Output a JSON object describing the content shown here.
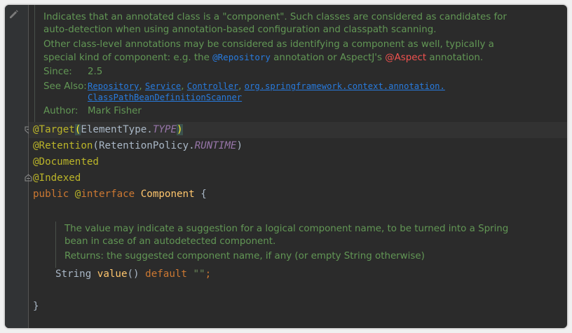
{
  "doc": {
    "paragraph1": "Indicates that an annotated class is a \"component\". Such classes are considered as candidates for auto-detection when using annotation-based configuration and classpath scanning.",
    "paragraph2_start": "Other class-level annotations may be considered as identifying a component as well, typically a special kind of component: e.g. the ",
    "repository_tag": "@Repository",
    "paragraph2_mid": " annotation or AspectJ's ",
    "aspect_tag": "@Aspect",
    "paragraph2_end": " annotation.",
    "since_label": "Since:",
    "since_value": "2.5",
    "see_also_label": "See Also:",
    "see_also": {
      "link1": "Repository",
      "link2": "Service",
      "link3": "Controller",
      "link4": "org.springframework.context.annotation.",
      "link4b": "ClassPathBeanDefinitionScanner",
      "sep": ", "
    },
    "author_label": "Author:",
    "author_value": "Mark Fisher"
  },
  "code": {
    "target_ann": "@Target",
    "paren_open": "(",
    "element_type": "ElementType.",
    "type_const": "TYPE",
    "paren_close": ")",
    "retention_ann": "@Retention",
    "retention_open": "(RetentionPolicy.",
    "runtime_const": "RUNTIME",
    "retention_close": ")",
    "documented_ann": "@Documented",
    "indexed_ann": "@Indexed",
    "public_kw": "public",
    "interface_at": "@",
    "interface_kw": "interface",
    "class_name": "Component",
    "brace_open": "{",
    "string_type": "String",
    "method_name": "value",
    "method_parens": "()",
    "default_kw": "default",
    "default_value": "\"\"",
    "semicolon": ";",
    "brace_close": "}"
  },
  "method_doc": {
    "text": "The value may indicate a suggestion for a logical component name, to be turned into a Spring bean in case of an autodetected component.",
    "returns": "Returns: the suggested component name, if any (or empty String otherwise)"
  },
  "colors": {
    "background": "#2b2b2b",
    "doc_text": "#629755",
    "annotation": "#bbb529",
    "keyword": "#cc7832",
    "link": "#287bde"
  },
  "icons": [
    "pencil-icon",
    "fold-marker-icon"
  ]
}
